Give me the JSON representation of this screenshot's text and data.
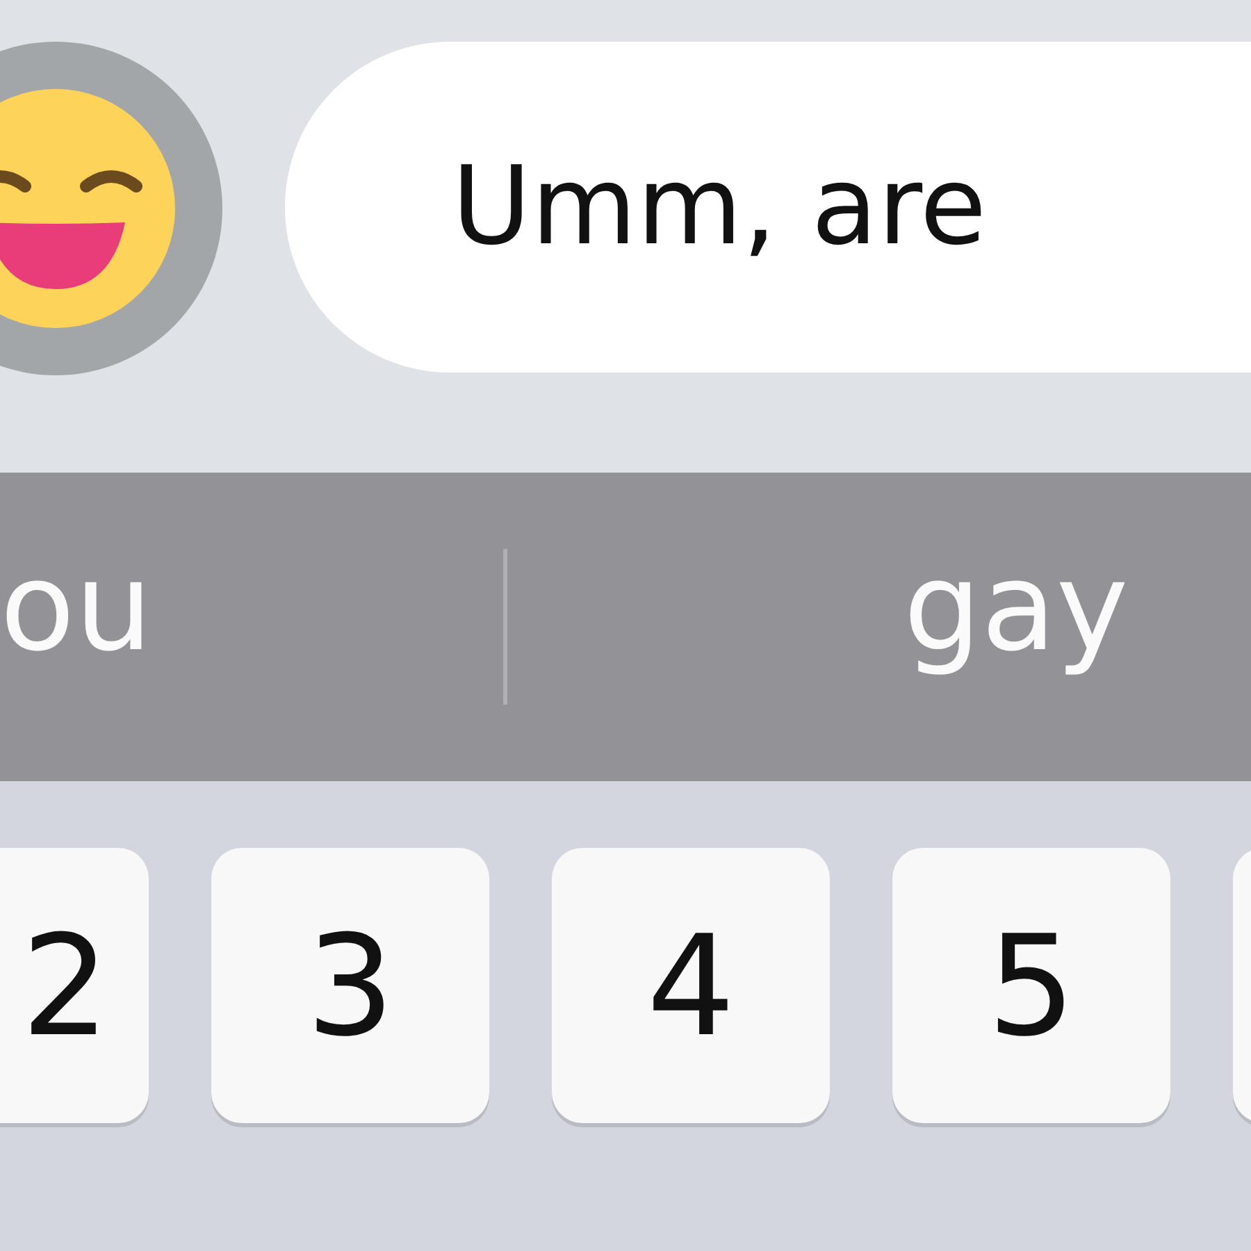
{
  "message": {
    "text": "Umm, are"
  },
  "suggestions": [
    {
      "text": "ou"
    },
    {
      "text": "gay"
    }
  ],
  "keys": [
    {
      "label": "2"
    },
    {
      "label": "3"
    },
    {
      "label": "4"
    },
    {
      "label": "5"
    }
  ]
}
